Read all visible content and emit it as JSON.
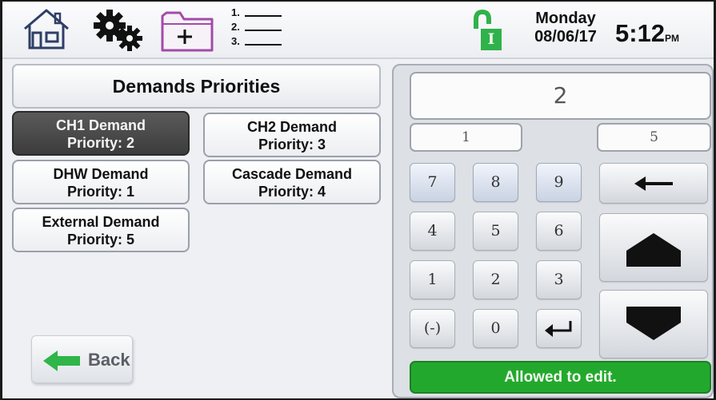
{
  "header": {
    "icons": {
      "home": "home-icon",
      "settings": "gears-icon",
      "add": "folder-add-icon",
      "list": "numbered-list-icon",
      "lock": "unlocked-padlock-icon"
    },
    "list_numbers": [
      "1.",
      "2.",
      "3."
    ],
    "lock_label": "I",
    "day": "Monday",
    "date": "08/06/17",
    "time": "5:12",
    "ampm": "PM"
  },
  "page": {
    "title": "Demands Priorities"
  },
  "demands": [
    {
      "name": "CH1 Demand",
      "priority": "Priority: 2",
      "selected": true
    },
    {
      "name": "CH2 Demand",
      "priority": "Priority: 3",
      "selected": false
    },
    {
      "name": "DHW Demand",
      "priority": "Priority: 1",
      "selected": false
    },
    {
      "name": "Cascade Demand",
      "priority": "Priority: 4",
      "selected": false
    },
    {
      "name": "External Demand",
      "priority": "Priority: 5",
      "selected": false
    }
  ],
  "back": {
    "label": "Back",
    "icon": "back-arrow-icon"
  },
  "keypad": {
    "value": "2",
    "min": "1",
    "max": "5",
    "keys": [
      "7",
      "8",
      "9",
      "4",
      "5",
      "6",
      "1",
      "2",
      "3",
      "(-)",
      "0"
    ],
    "enter_icon": "enter-icon",
    "backspace_icon": "backspace-arrow-icon",
    "up_icon": "increment-arrow-icon",
    "down_icon": "decrement-arrow-icon"
  },
  "status": {
    "text": "Allowed to edit."
  },
  "colors": {
    "status_green": "#22a92d",
    "lock_green": "#2fb24a",
    "selected_button": "#444444",
    "folder_purple": "#a34ba8",
    "back_arrow_green": "#2fb548"
  }
}
